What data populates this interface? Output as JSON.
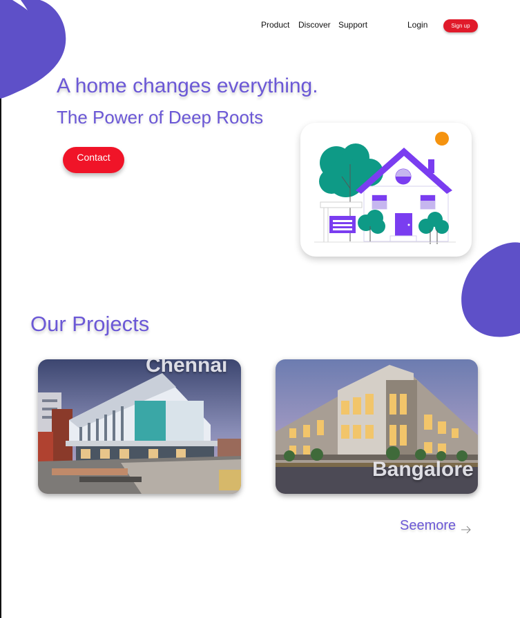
{
  "nav": {
    "links": [
      "Product",
      "Discover",
      "Support"
    ],
    "login": "Login",
    "signup": "Sign up"
  },
  "hero": {
    "title": "A home changes everything.",
    "subtitle": "The Power of Deep Roots",
    "contact": "Contact",
    "illustration_icon": "house-illustration"
  },
  "projects": {
    "title": "Our Projects",
    "cards": [
      {
        "city": "Chennai",
        "image_icon": "building-photo"
      },
      {
        "city": "Bangalore",
        "image_icon": "building-photo"
      }
    ],
    "seemore": "Seemore",
    "seemore_icon": "arrow-right-icon"
  },
  "colors": {
    "accent": "#6b58d6",
    "blob": "#5e50c8",
    "button_red": "#f01428"
  }
}
